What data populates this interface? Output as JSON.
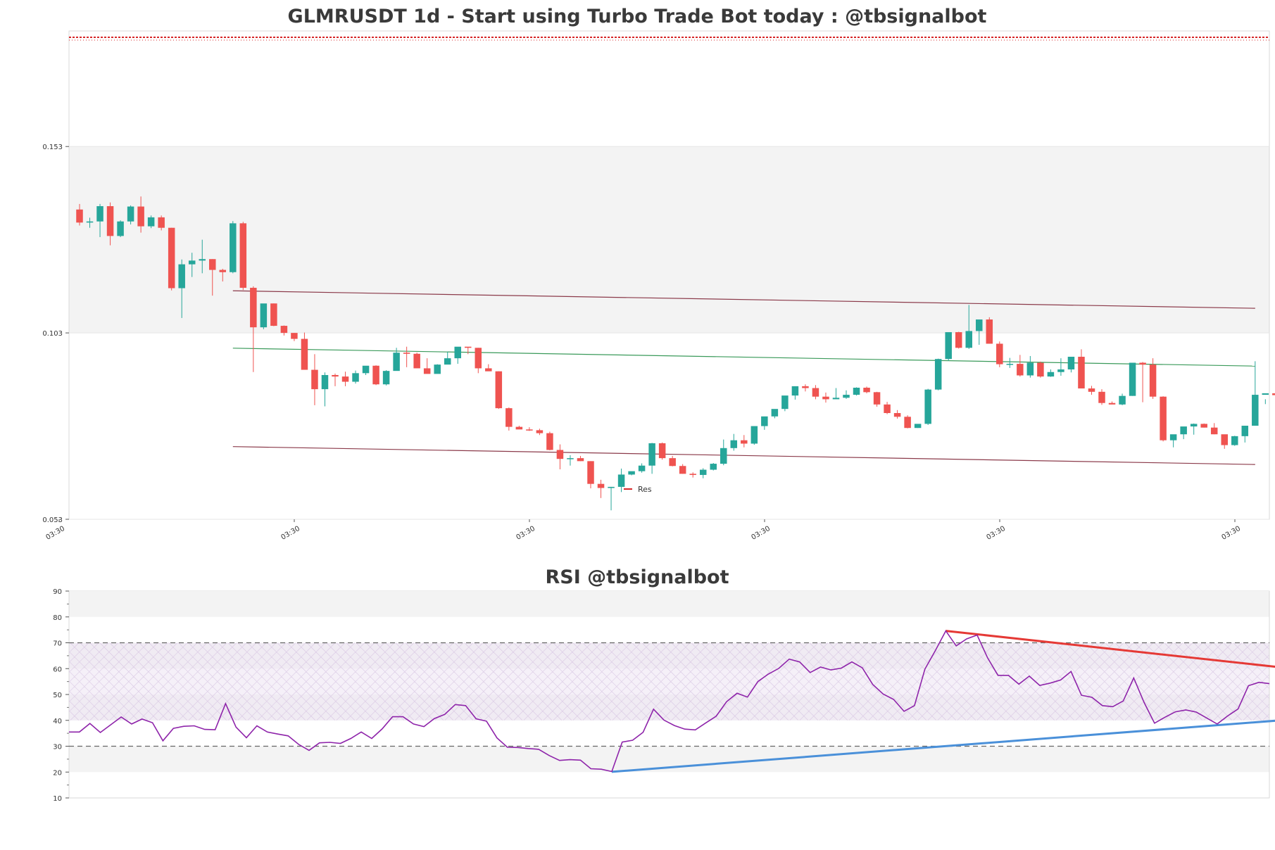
{
  "chart_data": [
    {
      "type": "candlestick",
      "title": "GLMRUSDT 1d - Start using Turbo Trade Bot today : @tbsignalbot",
      "ylim": [
        0.053,
        0.184
      ],
      "y_ticks": [
        "0.153",
        "0.103",
        "0.053"
      ],
      "x_ticks": [
        "03:30",
        "03:30",
        "03:30",
        "03:30",
        "03:30",
        "03:30"
      ],
      "shaded_band": [
        0.103,
        0.153
      ],
      "legend": {
        "label": "Res",
        "color": "#d62728",
        "placement": "center"
      },
      "colors": {
        "up": "#26a69a",
        "down": "#ef5350",
        "channel": "#8b3a4a",
        "midline": "#3a9a5a"
      },
      "candles": [
        [
          0.1361,
          0.1376,
          0.1318,
          0.1326
        ],
        [
          0.1326,
          0.1339,
          0.1312,
          0.1329
        ],
        [
          0.1329,
          0.1376,
          0.1287,
          0.137
        ],
        [
          0.137,
          0.138,
          0.1265,
          0.129
        ],
        [
          0.129,
          0.1332,
          0.1287,
          0.1329
        ],
        [
          0.1329,
          0.1372,
          0.1321,
          0.1369
        ],
        [
          0.1369,
          0.1396,
          0.1299,
          0.1316
        ],
        [
          0.1316,
          0.1345,
          0.1311,
          0.134
        ],
        [
          0.134,
          0.1345,
          0.1305,
          0.1312
        ],
        [
          0.1312,
          0.1312,
          0.1144,
          0.115
        ],
        [
          0.115,
          0.1227,
          0.107,
          0.1214
        ],
        [
          0.1214,
          0.1245,
          0.118,
          0.1224
        ],
        [
          0.1224,
          0.128,
          0.119,
          0.1228
        ],
        [
          0.1228,
          0.1228,
          0.113,
          0.1199
        ],
        [
          0.1199,
          0.1202,
          0.1168,
          0.1193
        ],
        [
          0.1193,
          0.133,
          0.119,
          0.1324
        ],
        [
          0.1324,
          0.1328,
          0.1145,
          0.1151
        ],
        [
          0.1151,
          0.1155,
          0.0925,
          0.1045
        ],
        [
          0.1045,
          0.1108,
          0.104,
          0.1109
        ],
        [
          0.1109,
          0.1109,
          0.1048,
          0.1049
        ],
        [
          0.1049,
          0.105,
          0.1023,
          0.103
        ],
        [
          0.103,
          0.103,
          0.1008,
          0.1014
        ],
        [
          0.1014,
          0.1031,
          0.0935,
          0.0931
        ],
        [
          0.0931,
          0.0973,
          0.0836,
          0.0879
        ],
        [
          0.0879,
          0.0924,
          0.0833,
          0.0917
        ],
        [
          0.0917,
          0.0921,
          0.0887,
          0.0913
        ],
        [
          0.0913,
          0.0926,
          0.0887,
          0.0899
        ],
        [
          0.0899,
          0.0929,
          0.0894,
          0.0922
        ],
        [
          0.0922,
          0.0929,
          0.0917,
          0.0942
        ],
        [
          0.0942,
          0.0943,
          0.089,
          0.0892
        ],
        [
          0.0892,
          0.093,
          0.0889,
          0.0928
        ],
        [
          0.0928,
          0.099,
          0.0932,
          0.0977
        ],
        [
          0.0977,
          0.0993,
          0.0938,
          0.0974
        ],
        [
          0.0974,
          0.0977,
          0.0937,
          0.0935
        ],
        [
          0.0935,
          0.0962,
          0.0926,
          0.092
        ],
        [
          0.092,
          0.0946,
          0.0921,
          0.0945
        ],
        [
          0.0945,
          0.0979,
          0.095,
          0.0962
        ],
        [
          0.0962,
          0.098,
          0.0947,
          0.0993
        ],
        [
          0.0993,
          0.0991,
          0.0973,
          0.099
        ],
        [
          0.099,
          0.099,
          0.0922,
          0.0935
        ],
        [
          0.0935,
          0.0946,
          0.0932,
          0.0927
        ],
        [
          0.0927,
          0.0927,
          0.0826,
          0.0828
        ],
        [
          0.0828,
          0.083,
          0.0768,
          0.0778
        ],
        [
          0.0778,
          0.0781,
          0.0772,
          0.0771
        ],
        [
          0.0771,
          0.0777,
          0.0767,
          0.0769
        ],
        [
          0.0769,
          0.0773,
          0.0756,
          0.0761
        ],
        [
          0.0761,
          0.0765,
          0.0715,
          0.0716
        ],
        [
          0.0716,
          0.0731,
          0.0664,
          0.0692
        ],
        [
          0.0692,
          0.0702,
          0.0674,
          0.0694
        ],
        [
          0.0694,
          0.07,
          0.0686,
          0.0686
        ],
        [
          0.0686,
          0.0686,
          0.0613,
          0.0625
        ],
        [
          0.0625,
          0.0636,
          0.0587,
          0.0614
        ],
        [
          0.0614,
          0.0617,
          0.0554,
          0.0617
        ],
        [
          0.0617,
          0.0666,
          0.0603,
          0.065
        ],
        [
          0.065,
          0.0657,
          0.0648,
          0.0659
        ],
        [
          0.0659,
          0.068,
          0.0655,
          0.0674
        ],
        [
          0.0674,
          0.0735,
          0.0652,
          0.0734
        ],
        [
          0.0734,
          0.0736,
          0.069,
          0.0694
        ],
        [
          0.0694,
          0.07,
          0.0672,
          0.0673
        ],
        [
          0.0673,
          0.0678,
          0.0652,
          0.0652
        ],
        [
          0.0652,
          0.0656,
          0.0642,
          0.0649
        ],
        [
          0.0649,
          0.0667,
          0.064,
          0.0663
        ],
        [
          0.0663,
          0.0681,
          0.0661,
          0.0679
        ],
        [
          0.0679,
          0.0744,
          0.0675,
          0.0721
        ],
        [
          0.0721,
          0.0759,
          0.0714,
          0.0742
        ],
        [
          0.0742,
          0.0756,
          0.0723,
          0.0733
        ],
        [
          0.0733,
          0.0774,
          0.073,
          0.078
        ],
        [
          0.078,
          0.0799,
          0.077,
          0.0806
        ],
        [
          0.0806,
          0.082,
          0.0801,
          0.0826
        ],
        [
          0.0826,
          0.0859,
          0.082,
          0.0862
        ],
        [
          0.0862,
          0.0885,
          0.0851,
          0.0887
        ],
        [
          0.0887,
          0.0892,
          0.0873,
          0.0882
        ],
        [
          0.0882,
          0.089,
          0.0852,
          0.0859
        ],
        [
          0.0859,
          0.087,
          0.0843,
          0.0852
        ],
        [
          0.0852,
          0.0882,
          0.0853,
          0.0856
        ],
        [
          0.0856,
          0.0876,
          0.0853,
          0.0864
        ],
        [
          0.0864,
          0.0884,
          0.0862,
          0.0883
        ],
        [
          0.0883,
          0.0886,
          0.0868,
          0.0871
        ],
        [
          0.0871,
          0.0872,
          0.0832,
          0.0838
        ],
        [
          0.0838,
          0.0845,
          0.0812,
          0.0815
        ],
        [
          0.0815,
          0.0823,
          0.08,
          0.0805
        ],
        [
          0.0805,
          0.0809,
          0.0774,
          0.0775
        ],
        [
          0.0775,
          0.0779,
          0.0775,
          0.0786
        ],
        [
          0.0786,
          0.088,
          0.0783,
          0.0878
        ],
        [
          0.0878,
          0.0961,
          0.0876,
          0.096
        ],
        [
          0.096,
          0.103,
          0.0955,
          0.1032
        ],
        [
          0.1032,
          0.1033,
          0.0988,
          0.099
        ],
        [
          0.099,
          0.1105,
          0.0987,
          0.1035
        ],
        [
          0.1035,
          0.1063,
          0.0998,
          0.1066
        ],
        [
          0.1066,
          0.1072,
          0.1001,
          0.1001
        ],
        [
          0.1001,
          0.1007,
          0.0938,
          0.0946
        ],
        [
          0.0946,
          0.0963,
          0.0936,
          0.0947
        ],
        [
          0.0947,
          0.0971,
          0.0913,
          0.0916
        ],
        [
          0.0916,
          0.0968,
          0.091,
          0.095
        ],
        [
          0.095,
          0.0953,
          0.091,
          0.0913
        ],
        [
          0.0913,
          0.0932,
          0.0912,
          0.0925
        ],
        [
          0.0925,
          0.0962,
          0.0915,
          0.0932
        ],
        [
          0.0932,
          0.0955,
          0.0924,
          0.0966
        ],
        [
          0.0966,
          0.0986,
          0.0887,
          0.0881
        ],
        [
          0.0881,
          0.0888,
          0.0864,
          0.0872
        ],
        [
          0.0872,
          0.0879,
          0.0837,
          0.0842
        ],
        [
          0.0842,
          0.0846,
          0.0839,
          0.0838
        ],
        [
          0.0838,
          0.0867,
          0.0836,
          0.0861
        ],
        [
          0.0861,
          0.094,
          0.0861,
          0.095
        ],
        [
          0.095,
          0.0952,
          0.0844,
          0.0945
        ],
        [
          0.0945,
          0.0962,
          0.0853,
          0.0859
        ],
        [
          0.0859,
          0.086,
          0.0739,
          0.0742
        ],
        [
          0.0742,
          0.0757,
          0.0723,
          0.0758
        ],
        [
          0.0758,
          0.0766,
          0.0745,
          0.0779
        ],
        [
          0.0779,
          0.0787,
          0.0757,
          0.0786
        ],
        [
          0.0786,
          0.0787,
          0.0776,
          0.0776
        ],
        [
          0.0776,
          0.0788,
          0.0758,
          0.0758
        ],
        [
          0.0758,
          0.0751,
          0.0719,
          0.0729
        ],
        [
          0.0729,
          0.0754,
          0.0727,
          0.0753
        ],
        [
          0.0753,
          0.0781,
          0.0736,
          0.0781
        ],
        [
          0.0781,
          0.0954,
          0.0781,
          0.0864
        ],
        [
          0.0864,
          0.0852,
          0.0839,
          0.0868
        ],
        [
          0.0868,
          0.0878,
          0.0851,
          0.0863
        ]
      ],
      "channel_lines": [
        {
          "name": "upper",
          "x": [
            15,
            115
          ],
          "y": [
            0.1143,
            0.1096
          ]
        },
        {
          "name": "middle",
          "x": [
            15,
            115
          ],
          "y": [
            0.0989,
            0.0941
          ]
        },
        {
          "name": "lower",
          "x": [
            15,
            115
          ],
          "y": [
            0.0725,
            0.0677
          ]
        }
      ]
    },
    {
      "type": "line",
      "title": "RSI @tbsignalbot",
      "ylim": [
        10,
        90
      ],
      "y_ticks": [
        "90",
        "80",
        "70",
        "60",
        "50",
        "40",
        "30",
        "20",
        "10"
      ],
      "reference_lines": [
        70,
        30
      ],
      "shaded_bands": [
        [
          80,
          90
        ],
        [
          60,
          70
        ],
        [
          40,
          50
        ],
        [
          20,
          30
        ]
      ],
      "hatched_band": [
        40,
        70
      ],
      "colors": {
        "rsi": "#8e24aa",
        "resistance": "#e53935",
        "support": "#4a90d9",
        "reference": "#666666"
      },
      "values": [
        35.5,
        35.5,
        38.8,
        35.3,
        38.3,
        41.3,
        38.6,
        40.5,
        39.1,
        32.1,
        36.9,
        37.7,
        37.9,
        36.5,
        36.4,
        46.5,
        37.4,
        33.3,
        37.9,
        35.5,
        34.7,
        34.0,
        30.7,
        28.4,
        31.3,
        31.5,
        31.1,
        33.0,
        35.5,
        33.0,
        36.7,
        41.4,
        41.4,
        38.6,
        37.6,
        40.7,
        42.3,
        46.1,
        45.7,
        40.6,
        39.7,
        33.2,
        29.6,
        29.5,
        29.1,
        28.8,
        26.4,
        24.5,
        24.8,
        24.6,
        21.3,
        21.1,
        20.2,
        31.6,
        32.3,
        35.4,
        44.3,
        40.1,
        38.0,
        36.6,
        36.3,
        39.0,
        41.6,
        47.2,
        50.5,
        49.0,
        55.0,
        57.9,
        60.1,
        63.7,
        62.6,
        58.5,
        60.6,
        59.5,
        60.2,
        62.6,
        60.3,
        53.9,
        50.2,
        48.1,
        43.5,
        45.7,
        59.8,
        67.0,
        74.6,
        68.8,
        71.5,
        73.0,
        64.2,
        57.4,
        57.4,
        54.0,
        57.1,
        53.5,
        54.4,
        55.6,
        58.9,
        49.7,
        48.9,
        45.7,
        45.3,
        47.5,
        56.4,
        46.9,
        38.9,
        41.2,
        43.3,
        44.0,
        43.2,
        40.9,
        38.6,
        41.7,
        44.4,
        53.4,
        54.7,
        54.2
      ],
      "trendlines": [
        {
          "name": "resistance",
          "x": [
            84,
            117
          ],
          "y": [
            74.6,
            60.1
          ]
        },
        {
          "name": "support",
          "x": [
            52,
            117
          ],
          "y": [
            20.1,
            40.3
          ]
        }
      ]
    }
  ]
}
